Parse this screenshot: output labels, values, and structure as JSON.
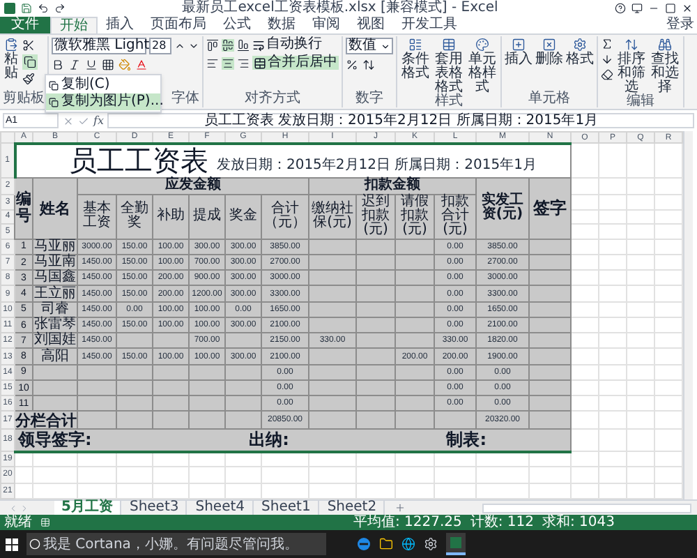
{
  "window": {
    "title": "最新员工excel工资表模板.xlsx [兼容模式] - Excel"
  },
  "file_tab": "文件",
  "menu_tabs": [
    {
      "label": "开始",
      "selected": true
    },
    {
      "label": "插入",
      "selected": false
    },
    {
      "label": "页面布局",
      "selected": false
    },
    {
      "label": "公式",
      "selected": false
    },
    {
      "label": "数据",
      "selected": false
    },
    {
      "label": "审阅",
      "selected": false
    },
    {
      "label": "视图",
      "selected": false
    },
    {
      "label": "开发工具",
      "selected": false
    }
  ],
  "account": "登录",
  "ribbon": [
    {
      "kind": "clipboard",
      "label": "剪贴板",
      "paste": "粘贴"
    },
    {
      "kind": "font",
      "label": "字体",
      "font_name": "微软雅黑 Light",
      "font_size": "28"
    },
    {
      "kind": "alignment",
      "label": "对齐方式",
      "center_on": true,
      "wrap": "自动换行",
      "merge": {
        "label": "合并后居中",
        "on": true
      }
    },
    {
      "kind": "number",
      "label": "数字",
      "format": "数值"
    },
    {
      "kind": "styles",
      "label": "样式",
      "buttons": [
        "条件格式",
        "套用表格格式",
        "单元格样式"
      ]
    },
    {
      "kind": "cells",
      "label": "单元格",
      "buttons": [
        "插入",
        "删除",
        "格式"
      ]
    },
    {
      "kind": "editing",
      "label": "编辑",
      "buttons": [
        "排序和筛选",
        "查找和选择"
      ]
    }
  ],
  "paste_menu": [
    "复制(C)",
    "复制为图片(P)..."
  ],
  "formula_bar": {
    "name_box": "A1",
    "fx": "fx",
    "formula": "员工工资表  发放日期：2015年2月12日  所属日期：2015年1月"
  },
  "columns": [
    "A",
    "B",
    "C",
    "D",
    "E",
    "F",
    "G",
    "H",
    "I",
    "J",
    "K",
    "L",
    "M",
    "N",
    "O",
    "P",
    "Q",
    "R"
  ],
  "sheet": {
    "title_row": "1",
    "title": "员工工资表",
    "subtitle": "发放日期：2015年2月12日 所属日期：2015年1月",
    "header_rows": [
      "2",
      "3",
      "4",
      "5"
    ],
    "id_header": "编号",
    "name_header": "姓名",
    "earn_group": "应发金额",
    "earn_columns": [
      "基本工资",
      "全勤奖",
      "补助",
      "提成",
      "奖金",
      "合计（元）"
    ],
    "deduct_group": "扣款金额",
    "deduct_columns": [
      "缴纳社保(元)",
      "迟到扣款(元)",
      "请假扣款(元)",
      "扣款合计(元)"
    ],
    "net_header": "实发工资(元)",
    "sign_header": "签字",
    "rows": [
      {
        "row": "6",
        "no": "1",
        "name": "马亚丽",
        "cells": {
          "C": "3000.00",
          "D": "150.00",
          "E": "100.00",
          "F": "300.00",
          "G": "300.00",
          "H": "3850.00",
          "L": "0.00",
          "M": "3850.00"
        }
      },
      {
        "row": "7",
        "no": "2",
        "name": "马亚南",
        "cells": {
          "C": "1450.00",
          "D": "150.00",
          "E": "100.00",
          "F": "700.00",
          "G": "300.00",
          "H": "2700.00",
          "L": "0.00",
          "M": "2700.00"
        }
      },
      {
        "row": "8",
        "no": "3",
        "name": "马国鑫",
        "cells": {
          "C": "1450.00",
          "D": "150.00",
          "E": "200.00",
          "F": "900.00",
          "G": "300.00",
          "H": "3000.00",
          "L": "0.00",
          "M": "3000.00"
        }
      },
      {
        "row": "9",
        "no": "4",
        "name": "王立丽",
        "cells": {
          "C": "1450.00",
          "D": "150.00",
          "E": "200.00",
          "F": "1200.00",
          "G": "300.00",
          "H": "3300.00",
          "L": "0.00",
          "M": "3300.00"
        }
      },
      {
        "row": "10",
        "no": "5",
        "name": "司睿",
        "cells": {
          "C": "1450.00",
          "D": "0.00",
          "E": "100.00",
          "F": "100.00",
          "G": "0.00",
          "H": "1650.00",
          "L": "0.00",
          "M": "1650.00"
        }
      },
      {
        "row": "11",
        "no": "6",
        "name": "张雷琴",
        "cells": {
          "C": "1450.00",
          "D": "150.00",
          "E": "100.00",
          "F": "100.00",
          "G": "300.00",
          "H": "2100.00",
          "L": "0.00",
          "M": "2100.00"
        }
      },
      {
        "row": "12",
        "no": "7",
        "name": "刘国娃",
        "cells": {
          "C": "1450.00",
          "F": "700.00",
          "H": "2150.00",
          "I": "330.00",
          "L": "330.00",
          "M": "1820.00"
        }
      },
      {
        "row": "13",
        "no": "8",
        "name": "高阳",
        "cells": {
          "C": "1450.00",
          "D": "150.00",
          "E": "100.00",
          "F": "100.00",
          "G": "300.00",
          "H": "2100.00",
          "K": "200.00",
          "L": "200.00",
          "M": "1900.00"
        }
      },
      {
        "row": "14",
        "no": "9",
        "cells": {
          "H": "0.00",
          "L": "0.00",
          "M": "0.00"
        }
      },
      {
        "row": "15",
        "no": "10",
        "cells": {
          "H": "0.00",
          "L": "0.00",
          "M": "0.00"
        }
      },
      {
        "row": "16",
        "no": "11",
        "cells": {
          "H": "0.00",
          "L": "0.00",
          "M": "0.00"
        }
      }
    ],
    "total": {
      "row": "17",
      "label": "分栏合计",
      "cells": {
        "H": "20850.00",
        "M": "20320.00"
      }
    },
    "footer": {
      "row": "18",
      "items": [
        "领导签字:",
        "出纳:",
        "制表:"
      ]
    },
    "empty_rows": [
      "19",
      "20",
      "21"
    ]
  },
  "sheet_tabs": [
    {
      "label": "5月工资",
      "selected": true
    },
    {
      "label": "Sheet3",
      "selected": false
    },
    {
      "label": "Sheet4",
      "selected": false
    },
    {
      "label": "Sheet1",
      "selected": false
    },
    {
      "label": "Sheet2",
      "selected": false
    }
  ],
  "status_bar": {
    "ready": "就绪",
    "stats": [
      "平均值: 1227.25",
      "计数: 112",
      "求和: 1043"
    ]
  },
  "taskbar": {
    "search": {
      "placeholder": "我是 Cortana，小娜。有问题尽管问我。"
    }
  }
}
